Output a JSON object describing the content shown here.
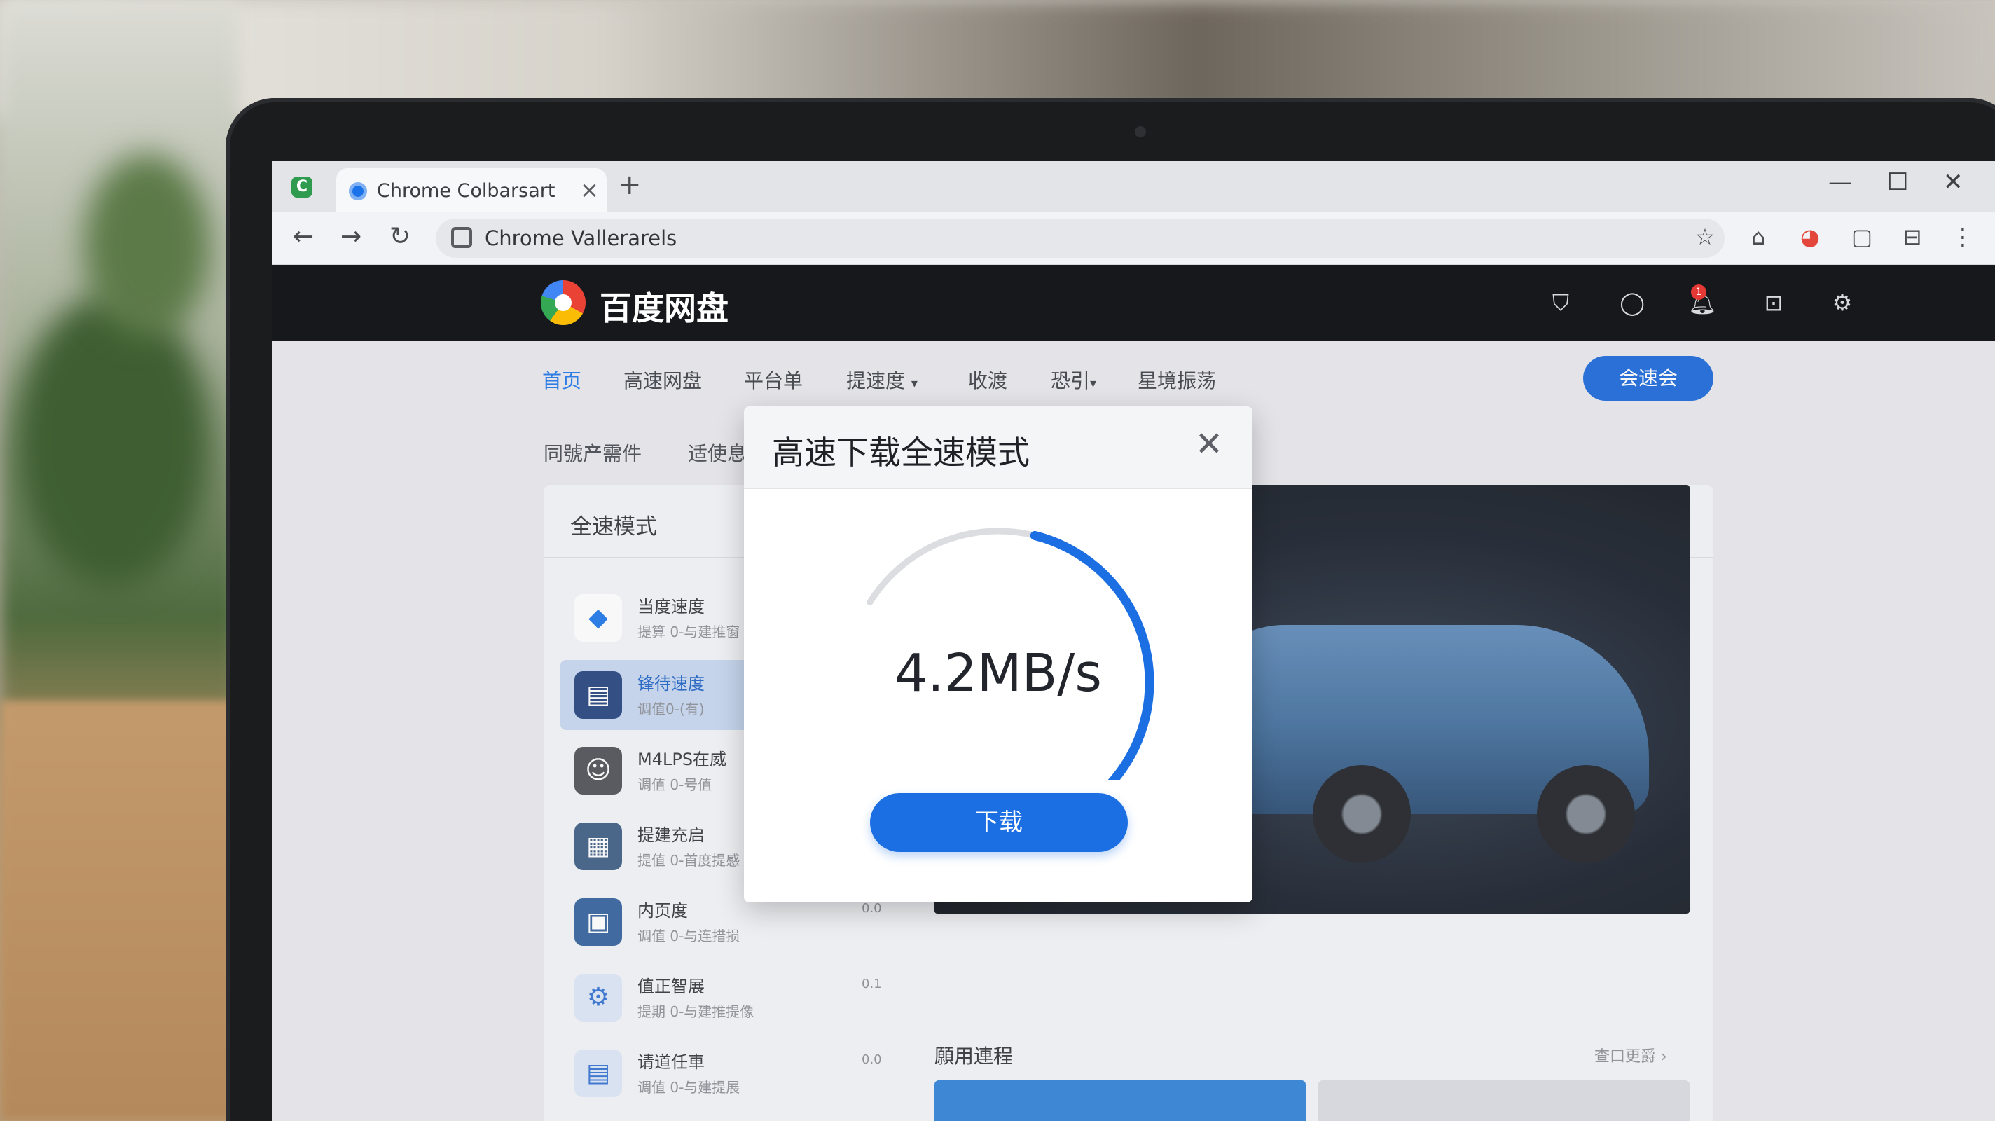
{
  "browser": {
    "tab_title": "Chrome Colbarsart",
    "tab_close": "×",
    "new_tab": "+",
    "url": "Chrome Vallerarels",
    "window_controls": [
      "—",
      "☐",
      "✕"
    ],
    "toolbar_icons": [
      "star-icon",
      "home-icon",
      "extension-icon",
      "window-icon",
      "sidepanel-icon",
      "more-icon"
    ]
  },
  "app": {
    "name": "百度网盘",
    "notification_count": "1",
    "header_icons": [
      "share-icon",
      "chat-icon",
      "bell-icon",
      "message-icon",
      "settings-icon"
    ]
  },
  "nav": {
    "items": [
      "首页",
      "高速网盘",
      "平台单",
      "提速度",
      "收渡",
      "恐引",
      "星境振荡"
    ],
    "active_index": 0,
    "cta_label": "会速会"
  },
  "subnav": {
    "items": [
      "同號产需件",
      "适使息"
    ]
  },
  "panel": {
    "title": "全速模式",
    "items": [
      {
        "title": "当度速度",
        "subtitle": "提算 0-与建推窗",
        "meta": "",
        "icon_color": "#ffffff",
        "selected": false
      },
      {
        "title": "锋待速度",
        "subtitle": "调值0-(有)",
        "meta": "",
        "icon_color": "#1f3f7a",
        "selected": true
      },
      {
        "title": "M4LPS在威",
        "subtitle": "调值 0-号值",
        "meta": "",
        "icon_color": "#4a4d53",
        "selected": false
      },
      {
        "title": "提建充启",
        "subtitle": "提值 0-首度提感",
        "meta": "",
        "icon_color": "#3a5a80",
        "selected": false
      },
      {
        "title": "内页度",
        "subtitle": "调值 0-与连措损",
        "meta": "0.0",
        "icon_color": "#2f5f9a",
        "selected": false
      },
      {
        "title": "值正智展",
        "subtitle": "提期 0-与建推提像",
        "meta": "0.1",
        "icon_color": "#dbe6f5",
        "selected": false
      },
      {
        "title": "请道任車",
        "subtitle": "调值 0-与建提展",
        "meta": "0.0",
        "icon_color": "#dbe6f5",
        "selected": false
      }
    ]
  },
  "section": {
    "title": "願用連程",
    "more": "查口更爵 ›"
  },
  "modal": {
    "title": "高速下载全速模式",
    "close": "✕",
    "speed": "4.2MB/s",
    "progress": 0.5,
    "button_label": "下载",
    "colors": {
      "track": "#dcdde1",
      "progress": "#1c6fe3",
      "peak": "#f07a1a"
    }
  }
}
